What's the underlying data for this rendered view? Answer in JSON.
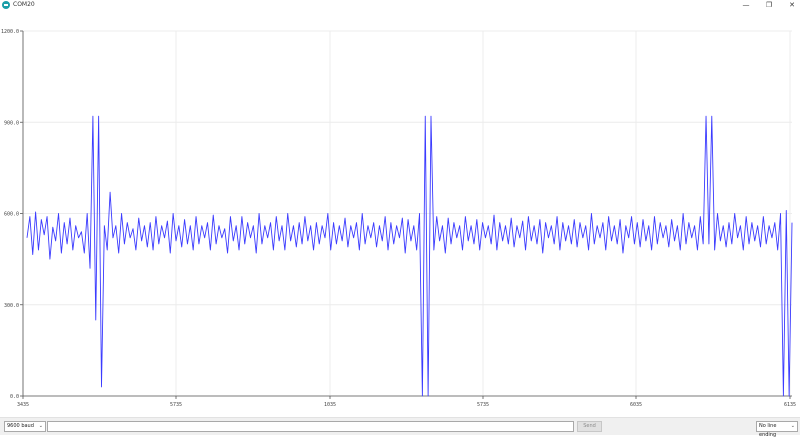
{
  "window": {
    "title": "COM20",
    "minimize_glyph": "—",
    "maximize_glyph": "❐",
    "close_glyph": "✕"
  },
  "chart_data": {
    "type": "line",
    "x_ticks": [
      "3435",
      "5735",
      "1035",
      "5735",
      "6035",
      "6135"
    ],
    "y_ticks": [
      "0.0",
      "300.0",
      "600.0",
      "900.0",
      "1200.0"
    ],
    "ylim": [
      0,
      1200
    ],
    "grid": true,
    "line_color": "#3b3bff",
    "series": [
      {
        "values": [
          520,
          590,
          465,
          605,
          480,
          580,
          530,
          590,
          450,
          555,
          510,
          600,
          470,
          570,
          500,
          585,
          480,
          560,
          520,
          540,
          470,
          600,
          420,
          920,
          250,
          920,
          30,
          560,
          480,
          670,
          520,
          560,
          470,
          600,
          500,
          570,
          520,
          550,
          480,
          585,
          510,
          560,
          490,
          570,
          480,
          590,
          500,
          560,
          520,
          575,
          470,
          600,
          510,
          560,
          490,
          580,
          500,
          560,
          480,
          590,
          500,
          560,
          520,
          570,
          480,
          595,
          500,
          560,
          520,
          550,
          470,
          590,
          510,
          560,
          480,
          590,
          500,
          570,
          520,
          560,
          470,
          600,
          500,
          560,
          520,
          570,
          480,
          590,
          510,
          560,
          480,
          600,
          510,
          560,
          490,
          570,
          500,
          590,
          510,
          560,
          480,
          570,
          500,
          560,
          520,
          600,
          480,
          570,
          500,
          560,
          510,
          585,
          490,
          560,
          520,
          570,
          480,
          600,
          500,
          560,
          520,
          570,
          490,
          560,
          510,
          590,
          480,
          570,
          500,
          560,
          520,
          585,
          470,
          580,
          510,
          560,
          480,
          600,
          0,
          920,
          0,
          920,
          480,
          590,
          510,
          560,
          470,
          585,
          500,
          570,
          520,
          560,
          480,
          590,
          510,
          560,
          500,
          580,
          480,
          570,
          520,
          560,
          500,
          595,
          480,
          570,
          510,
          560,
          500,
          585,
          490,
          560,
          520,
          575,
          480,
          590,
          510,
          560,
          500,
          580,
          470,
          570,
          520,
          560,
          500,
          590,
          480,
          570,
          510,
          560,
          500,
          580,
          490,
          570,
          520,
          560,
          480,
          600,
          500,
          560,
          520,
          570,
          480,
          590,
          510,
          560,
          500,
          580,
          470,
          560,
          520,
          590,
          500,
          570,
          490,
          580,
          510,
          560,
          480,
          590,
          500,
          570,
          520,
          560,
          490,
          580,
          510,
          560,
          480,
          600,
          500,
          570,
          520,
          560,
          480,
          590,
          500,
          920,
          500,
          920,
          480,
          600,
          510,
          560,
          490,
          570,
          500,
          600,
          520,
          560,
          480,
          590,
          500,
          570,
          510,
          560,
          490,
          590,
          500,
          560,
          520,
          570,
          480,
          600,
          0,
          610,
          0,
          570
        ]
      }
    ]
  },
  "bottom": {
    "baud": "9600 baud",
    "message_placeholder": "",
    "send_label": "Send",
    "line_ending": "No line ending"
  }
}
